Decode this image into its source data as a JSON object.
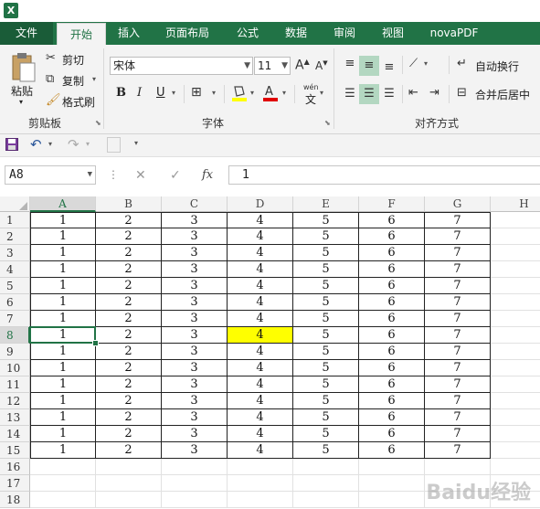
{
  "app": {
    "icon_text": "X"
  },
  "tabs": [
    {
      "label": "文件",
      "state": "file"
    },
    {
      "label": "开始",
      "state": "active"
    },
    {
      "label": "插入",
      "state": ""
    },
    {
      "label": "页面布局",
      "state": ""
    },
    {
      "label": "公式",
      "state": ""
    },
    {
      "label": "数据",
      "state": ""
    },
    {
      "label": "审阅",
      "state": ""
    },
    {
      "label": "视图",
      "state": ""
    },
    {
      "label": "novaPDF",
      "state": ""
    }
  ],
  "ribbon": {
    "clipboard": {
      "paste": "粘贴",
      "cut": "剪切",
      "copy": "复制",
      "format_painter": "格式刷",
      "group": "剪贴板"
    },
    "font": {
      "name": "宋体",
      "size": "11",
      "bold": "B",
      "italic": "I",
      "underline": "U",
      "group": "字体",
      "grow": "A",
      "shrink": "A",
      "phonetic": "wén",
      "phonetic_char": "文"
    },
    "alignment": {
      "wrap": "自动换行",
      "merge": "合并后居中",
      "group": "对齐方式"
    }
  },
  "formula_bar": {
    "name_box": "A8",
    "value": "1",
    "fx": "fx"
  },
  "columns": [
    "A",
    "B",
    "C",
    "D",
    "E",
    "F",
    "G",
    "H"
  ],
  "selected_column": "A",
  "selected_row": 8,
  "rows": [
    {
      "n": "1",
      "v": [
        "1",
        "2",
        "3",
        "4",
        "5",
        "6",
        "7"
      ]
    },
    {
      "n": "2",
      "v": [
        "1",
        "2",
        "3",
        "4",
        "5",
        "6",
        "7"
      ]
    },
    {
      "n": "3",
      "v": [
        "1",
        "2",
        "3",
        "4",
        "5",
        "6",
        "7"
      ]
    },
    {
      "n": "4",
      "v": [
        "1",
        "2",
        "3",
        "4",
        "5",
        "6",
        "7"
      ]
    },
    {
      "n": "5",
      "v": [
        "1",
        "2",
        "3",
        "4",
        "5",
        "6",
        "7"
      ]
    },
    {
      "n": "6",
      "v": [
        "1",
        "2",
        "3",
        "4",
        "5",
        "6",
        "7"
      ]
    },
    {
      "n": "7",
      "v": [
        "1",
        "2",
        "3",
        "4",
        "5",
        "6",
        "7"
      ]
    },
    {
      "n": "8",
      "v": [
        "1",
        "2",
        "3",
        "4",
        "5",
        "6",
        "7"
      ]
    },
    {
      "n": "9",
      "v": [
        "1",
        "2",
        "3",
        "4",
        "5",
        "6",
        "7"
      ]
    },
    {
      "n": "10",
      "v": [
        "1",
        "2",
        "3",
        "4",
        "5",
        "6",
        "7"
      ]
    },
    {
      "n": "11",
      "v": [
        "1",
        "2",
        "3",
        "4",
        "5",
        "6",
        "7"
      ]
    },
    {
      "n": "12",
      "v": [
        "1",
        "2",
        "3",
        "4",
        "5",
        "6",
        "7"
      ]
    },
    {
      "n": "13",
      "v": [
        "1",
        "2",
        "3",
        "4",
        "5",
        "6",
        "7"
      ]
    },
    {
      "n": "14",
      "v": [
        "1",
        "2",
        "3",
        "4",
        "5",
        "6",
        "7"
      ]
    },
    {
      "n": "15",
      "v": [
        "1",
        "2",
        "3",
        "4",
        "5",
        "6",
        "7"
      ]
    },
    {
      "n": "16",
      "v": []
    },
    {
      "n": "17",
      "v": []
    },
    {
      "n": "18",
      "v": []
    }
  ],
  "highlight": {
    "row": "8",
    "col": "D",
    "color": "#ffff00"
  },
  "colors": {
    "brand": "#217346"
  },
  "watermark": "Baidu经验"
}
